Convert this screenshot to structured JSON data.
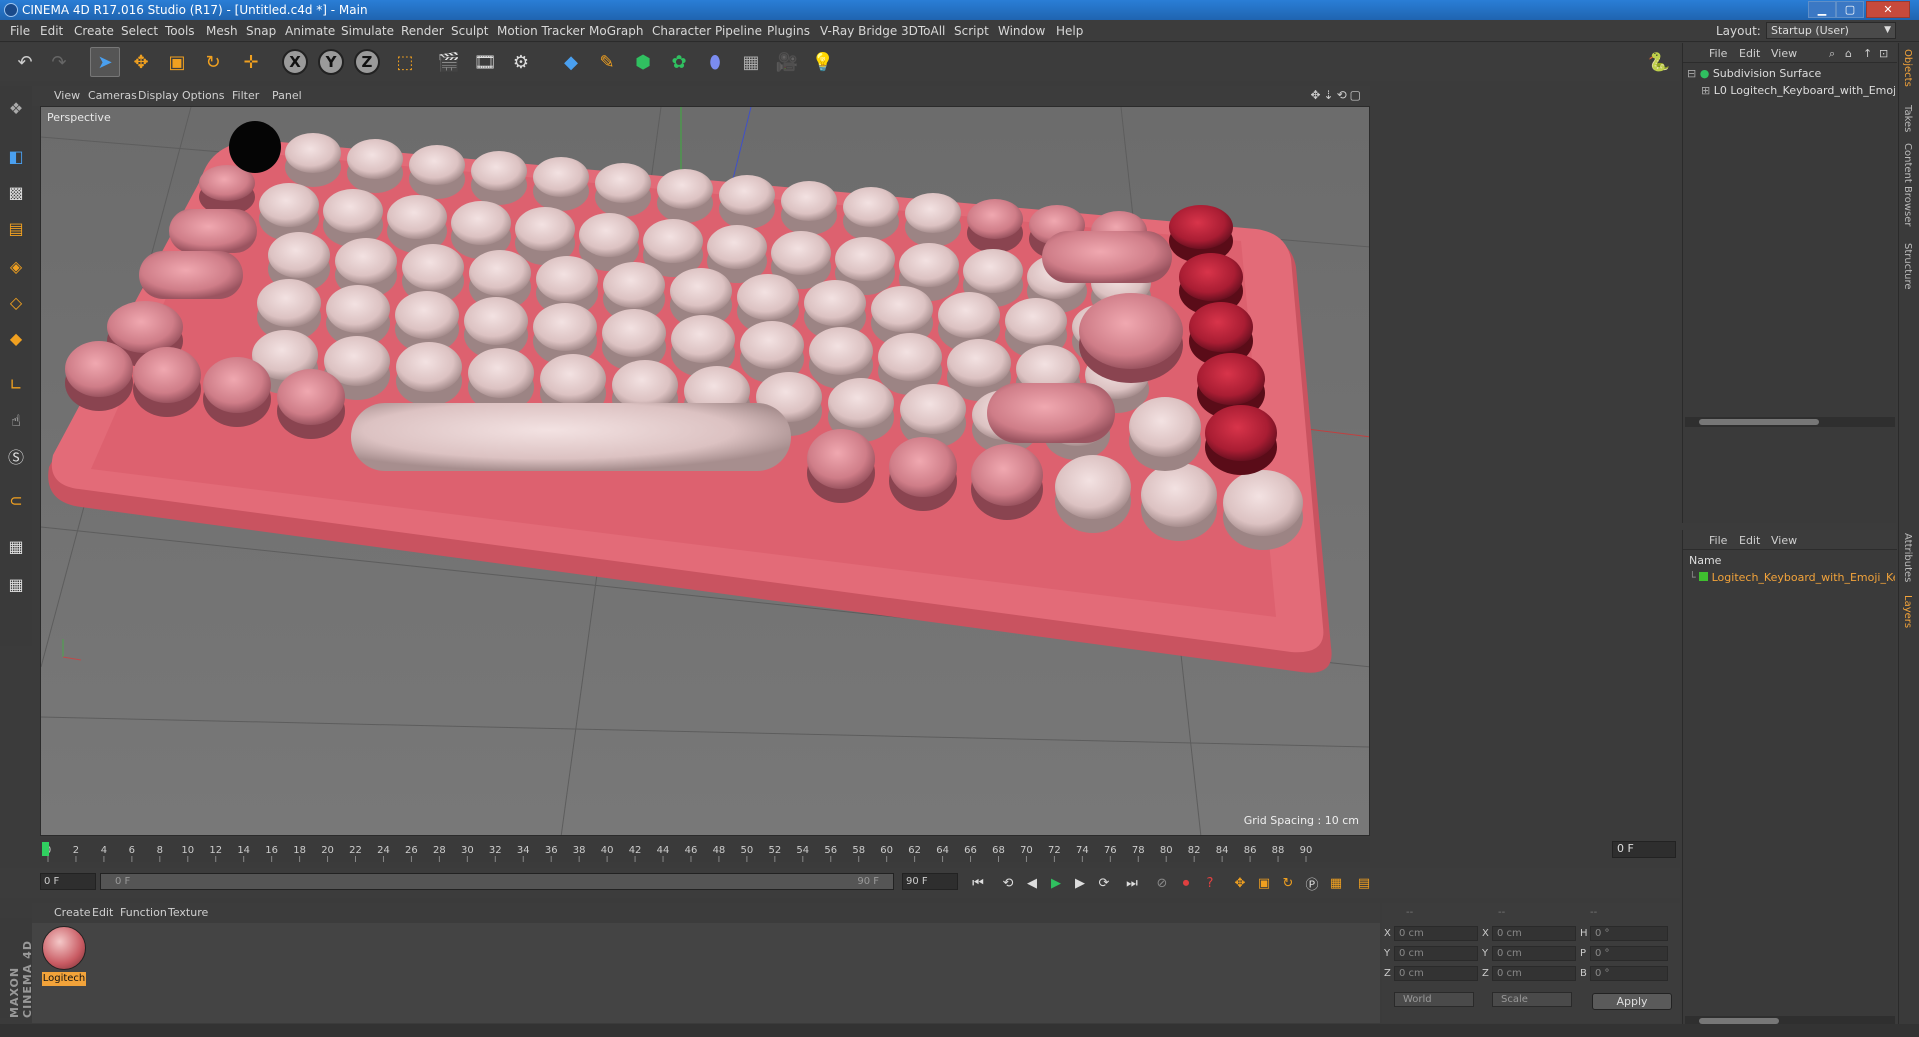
{
  "window": {
    "title": "CINEMA 4D R17.016 Studio (R17) - [Untitled.c4d *] - Main",
    "controls": [
      "minimize-icon",
      "maximize-icon",
      "close-icon"
    ]
  },
  "menu": [
    "File",
    "Edit",
    "Create",
    "Select",
    "Tools",
    "Mesh",
    "Snap",
    "Animate",
    "Simulate",
    "Render",
    "Sculpt",
    "Motion Tracker",
    "MoGraph",
    "Character",
    "Pipeline",
    "Plugins",
    "V-Ray Bridge",
    "3DToAll",
    "Script",
    "Window",
    "Help"
  ],
  "layout": {
    "label": "Layout:",
    "value": "Startup (User)"
  },
  "toolbar": {
    "icons": [
      "undo-icon",
      "redo-icon",
      "select-pointer-icon",
      "move-icon",
      "scale-icon",
      "rotate-icon",
      "live-select-icon",
      "x-axis-lock-icon",
      "y-axis-lock-icon",
      "z-axis-lock-icon",
      "world-coordinates-icon",
      "render-view-icon",
      "render-picture-viewer-icon",
      "edit-render-settings-icon",
      "cube-primitive-icon",
      "pen-spline-icon",
      "subdivision-surface-icon",
      "cloner-icon",
      "deformer-icon",
      "floor-icon",
      "camera-icon",
      "light-icon"
    ],
    "axis_labels": [
      "X",
      "Y",
      "Z"
    ]
  },
  "viewport": {
    "menu": [
      "View",
      "Cameras",
      "Display",
      "Options",
      "Filter",
      "Panel"
    ],
    "camera": "Perspective",
    "grid_spacing": "Grid Spacing : 10 cm",
    "model": "Logitech pink keyboard with round keycaps"
  },
  "timeline": {
    "ticks": [
      "0",
      "2",
      "4",
      "6",
      "8",
      "10",
      "12",
      "14",
      "16",
      "18",
      "20",
      "22",
      "24",
      "26",
      "28",
      "30",
      "32",
      "34",
      "36",
      "38",
      "40",
      "42",
      "44",
      "46",
      "48",
      "50",
      "52",
      "54",
      "56",
      "58",
      "60",
      "62",
      "64",
      "66",
      "68",
      "70",
      "72",
      "74",
      "76",
      "78",
      "80",
      "82",
      "84",
      "86",
      "88",
      "90"
    ],
    "current_frame": "0 F",
    "start_field": "0 F",
    "range_start": "0 F",
    "range_end": "90 F",
    "end_field": "90 F"
  },
  "materials": {
    "menu": [
      "Create",
      "Edit",
      "Function",
      "Texture"
    ],
    "items": [
      {
        "label": "Logitech"
      }
    ]
  },
  "coordinates": {
    "headers": [
      "--",
      "--",
      "--"
    ],
    "rows": [
      {
        "axis": "X",
        "pos": "0 cm",
        "size_axis": "X",
        "size": "0 cm",
        "rot_axis": "H",
        "rot": "0 °"
      },
      {
        "axis": "Y",
        "pos": "0 cm",
        "size_axis": "Y",
        "size": "0 cm",
        "rot_axis": "P",
        "rot": "0 °"
      },
      {
        "axis": "Z",
        "pos": "0 cm",
        "size_axis": "Z",
        "size": "0 cm",
        "rot_axis": "B",
        "rot": "0 °"
      }
    ],
    "mode_world": "World",
    "mode_scale": "Scale",
    "apply": "Apply"
  },
  "objects": {
    "menu": [
      "File",
      "Edit",
      "View"
    ],
    "items": [
      {
        "name": "Subdivision Surface"
      },
      {
        "name": "Logitech_Keyboard_with_Emoji_K"
      }
    ]
  },
  "layers": {
    "menu": [
      "File",
      "Edit",
      "View"
    ],
    "column": "Name",
    "items": [
      {
        "name": "Logitech_Keyboard_with_Emoji_Ke",
        "color": "#3fbf2f"
      }
    ]
  },
  "side_tabs": [
    "Objects",
    "Takes",
    "Content Browser",
    "Structure",
    "Attributes",
    "Layers"
  ],
  "brand": "MAXON CINEMA 4D",
  "colors": {
    "accent": "#f2a33a",
    "keyboard_body": "#e36b78",
    "keycap_light": "#e8cfcf",
    "keycap_red": "#b3233a"
  }
}
